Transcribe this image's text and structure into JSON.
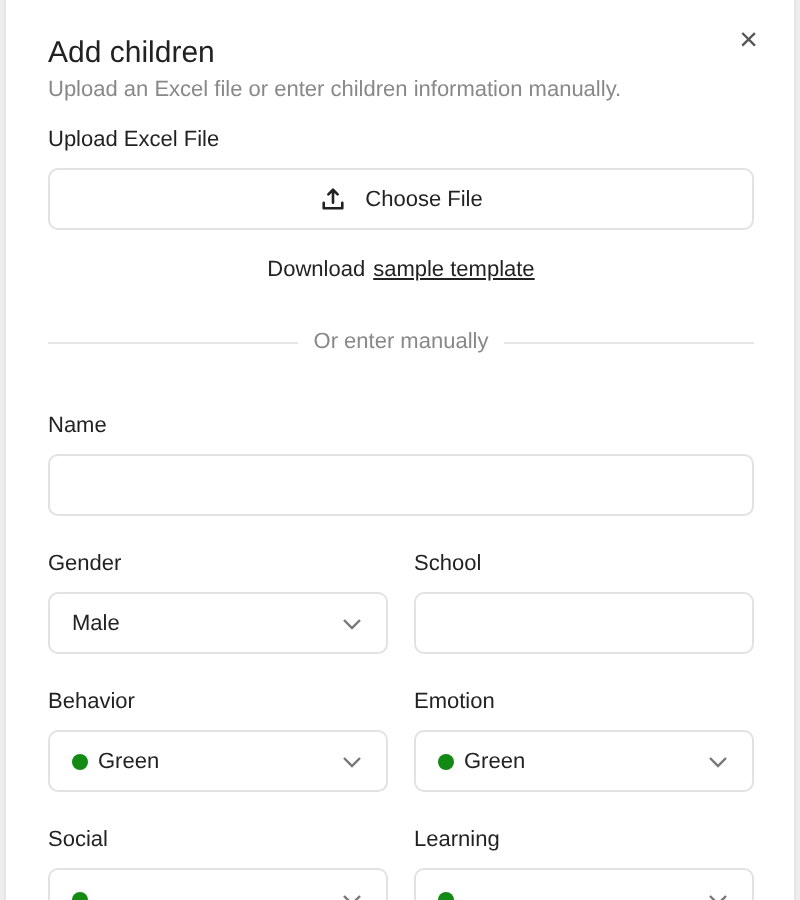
{
  "dialog": {
    "title": "Add children",
    "subtitle": "Upload an Excel file or enter children information manually.",
    "close_icon": "×"
  },
  "upload": {
    "label": "Upload Excel File",
    "button": "Choose File",
    "download_text": "Download",
    "download_link": "sample template"
  },
  "divider": "Or enter manually",
  "fields": [
    {
      "kind": "wide_text",
      "label": "Name"
    },
    {
      "kind": "select",
      "label": "Gender",
      "value": "Male"
    },
    {
      "kind": "text",
      "label": "School"
    },
    {
      "kind": "select",
      "label": "Behavior",
      "value": "Green",
      "color": "#138a13"
    },
    {
      "kind": "select",
      "label": "Emotion",
      "value": "Green",
      "color": "#138a13"
    },
    {
      "kind": "select",
      "label": "Social",
      "color": "#138a13"
    },
    {
      "kind": "select",
      "label": "Learning",
      "color": "#138a13"
    }
  ]
}
